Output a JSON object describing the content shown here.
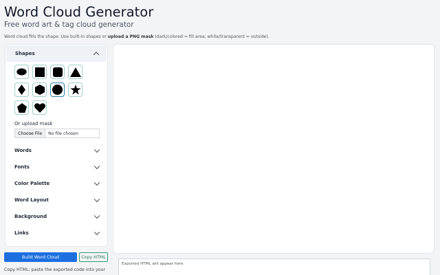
{
  "header": {
    "title": "Word Cloud Generator",
    "subtitle": "Free word art & tag cloud generator",
    "help_prefix": "Word cloud fills the shape. Use built-in shapes or ",
    "help_bold": "upload a PNG mask",
    "help_suffix": " (dark/colored = fill area; white/transparent = outside)."
  },
  "sidebar": {
    "shapes_label": "Shapes",
    "shapes": [
      {
        "name": "ellipse",
        "selected": false
      },
      {
        "name": "square",
        "selected": false
      },
      {
        "name": "rounded-square",
        "selected": false
      },
      {
        "name": "triangle",
        "selected": false
      },
      {
        "name": "diamond",
        "selected": false
      },
      {
        "name": "hexagon",
        "selected": false
      },
      {
        "name": "circle",
        "selected": true
      },
      {
        "name": "star",
        "selected": false
      },
      {
        "name": "pentagon",
        "selected": false
      },
      {
        "name": "heart",
        "selected": false
      }
    ],
    "mask_label": "Or upload mask",
    "file_button": "Choose File",
    "file_status": "No file chosen",
    "sections": [
      {
        "label": "Words"
      },
      {
        "label": "Fonts"
      },
      {
        "label": "Color Palette"
      },
      {
        "label": "Word Layout"
      },
      {
        "label": "Background"
      },
      {
        "label": "Links"
      }
    ]
  },
  "actions": {
    "build_label": "Build Word Cloud",
    "copy_label": "Copy HTML",
    "copy_help": "Copy HTML: paste the exported code into your"
  },
  "export": {
    "placeholder": "Exported HTML will appear here"
  },
  "colors": {
    "accent": "#1d6fe0",
    "copy_border": "#2e9b6f",
    "selected_shape_border": "#2b7fa6"
  }
}
